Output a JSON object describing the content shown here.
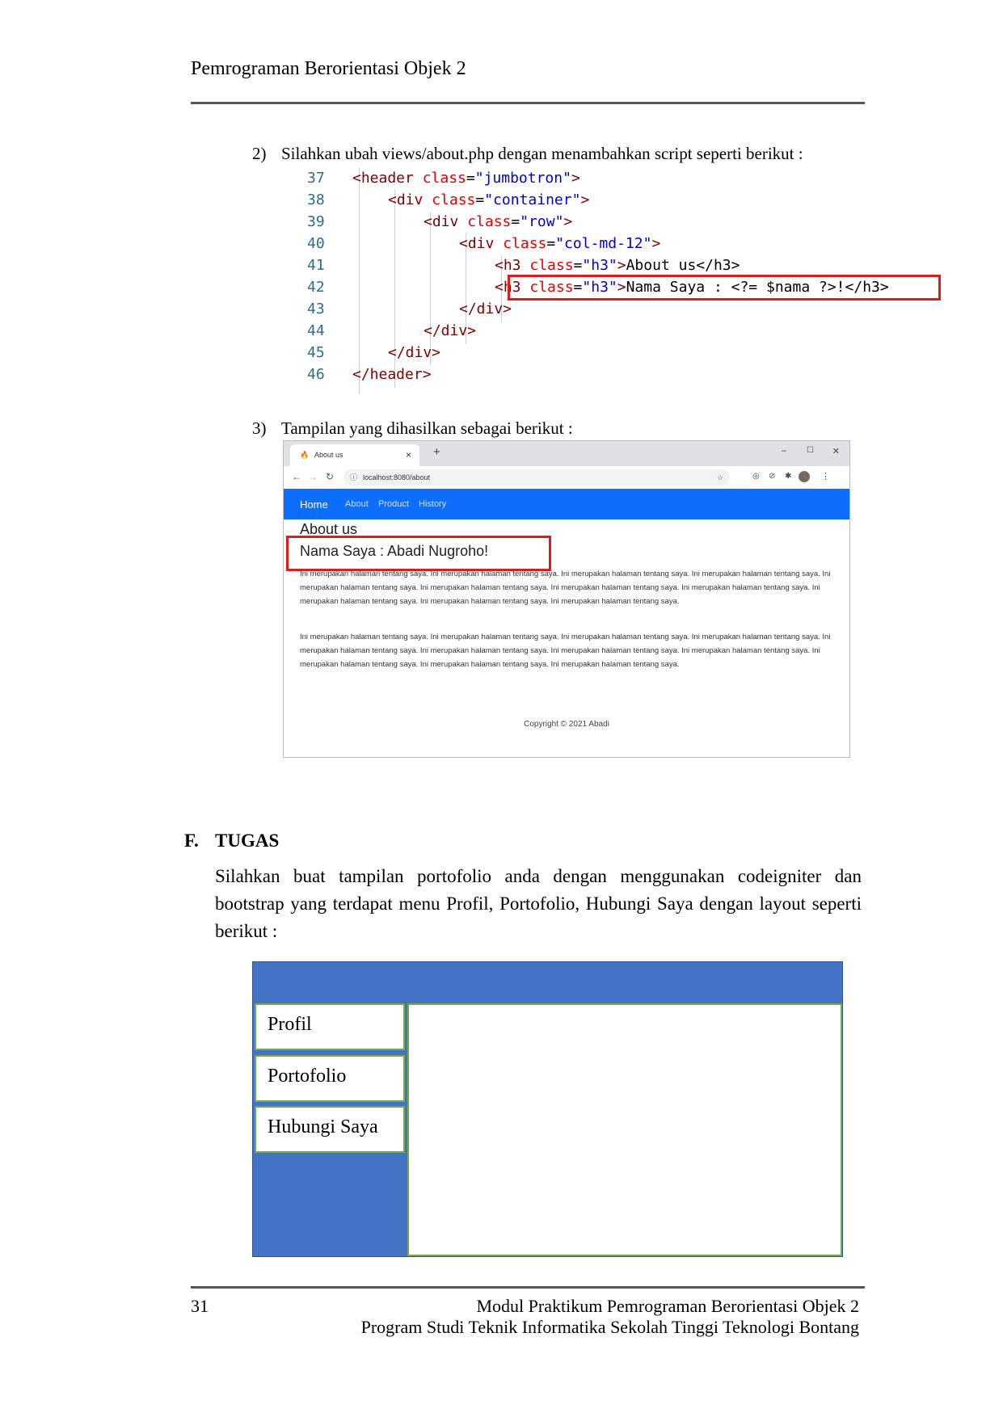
{
  "header": {
    "title": "Pemrograman Berorientasi Objek 2"
  },
  "step2": {
    "number": "2)",
    "text": "Silahkan ubah views/about.php dengan menambahkan script seperti berikut :"
  },
  "code": {
    "lines": [
      {
        "no": "37",
        "t1": "<header ",
        "a": "class",
        "eq": "=",
        "s": "\"jumbotron\"",
        "t2": ">",
        "rest": ""
      },
      {
        "no": "38",
        "t1": "<div ",
        "a": "class",
        "eq": "=",
        "s": "\"container\"",
        "t2": ">",
        "rest": ""
      },
      {
        "no": "39",
        "t1": "<div ",
        "a": "class",
        "eq": "=",
        "s": "\"row\"",
        "t2": ">",
        "rest": ""
      },
      {
        "no": "40",
        "t1": "<div ",
        "a": "class",
        "eq": "=",
        "s": "\"col-md-12\"",
        "t2": ">",
        "rest": ""
      },
      {
        "no": "41",
        "t1": "<h3 ",
        "a": "class",
        "eq": "=",
        "s": "\"h3\"",
        "t2": ">",
        "rest": "About us</h3>"
      },
      {
        "no": "42",
        "t1": "<h3 ",
        "a": "class",
        "eq": "=",
        "s": "\"h3\"",
        "t2": ">",
        "rest": "Nama Saya : <?= $nama ?>!</h3>"
      },
      {
        "no": "43",
        "t1": "</div>",
        "a": "",
        "eq": "",
        "s": "",
        "t2": "",
        "rest": ""
      },
      {
        "no": "44",
        "t1": "</div>",
        "a": "",
        "eq": "",
        "s": "",
        "t2": "",
        "rest": ""
      },
      {
        "no": "45",
        "t1": "</div>",
        "a": "",
        "eq": "",
        "s": "",
        "t2": "",
        "rest": ""
      },
      {
        "no": "46",
        "t1": "</header>",
        "a": "",
        "eq": "",
        "s": "",
        "t2": "",
        "rest": ""
      }
    ]
  },
  "step3": {
    "number": "3)",
    "text": "Tampilan yang dihasilkan sebagai berikut :"
  },
  "browser": {
    "tab_title": "About us",
    "tab_close": "×",
    "new_tab": "+",
    "win_min": "–",
    "win_max": "☐",
    "win_close": "✕",
    "url": "localhost:8080/about",
    "nav": {
      "home": "Home",
      "about": "About",
      "product": "Product",
      "history": "History"
    },
    "h3_about": "About us",
    "h3_name": "Nama Saya : Abadi Nugroho!",
    "para1": "Ini merupakan halaman tentang saya. Ini merupakan halaman tentang saya. Ini merupakan halaman tentang saya. Ini merupakan halaman tentang saya. Ini merupakan halaman tentang saya. Ini merupakan halaman tentang saya. Ini merupakan halaman tentang saya. Ini merupakan halaman tentang saya. Ini merupakan halaman tentang saya. Ini merupakan halaman tentang saya. Ini merupakan halaman tentang saya.",
    "para2": "Ini merupakan halaman tentang saya. Ini merupakan halaman tentang saya. Ini merupakan halaman tentang saya. Ini merupakan halaman tentang saya. Ini merupakan halaman tentang saya. Ini merupakan halaman tentang saya. Ini merupakan halaman tentang saya. Ini merupakan halaman tentang saya. Ini merupakan halaman tentang saya. Ini merupakan halaman tentang saya. Ini merupakan halaman tentang saya.",
    "copyright": "Copyright © 2021 Abadi"
  },
  "section_f": {
    "label": "F.",
    "title": "TUGAS",
    "paragraph": "Silahkan buat tampilan portofolio anda dengan menggunakan codeigniter dan bootstrap yang terdapat menu Profil, Portofolio, Hubungi Saya dengan layout seperti berikut :"
  },
  "layout_menu": [
    "Profil",
    "Portofolio",
    "Hubungi Saya"
  ],
  "footer": {
    "page_number": "31",
    "line1": "Modul Praktikum Pemrograman Berorientasi Objek 2",
    "line2": "Program Studi Teknik Informatika Sekolah Tinggi Teknologi Bontang"
  },
  "colors": {
    "highlight_red": "#e01b1b",
    "navbar_blue": "#0d6efd",
    "diagram_blue": "#4472c4",
    "diagram_border_green": "#70ad47"
  }
}
